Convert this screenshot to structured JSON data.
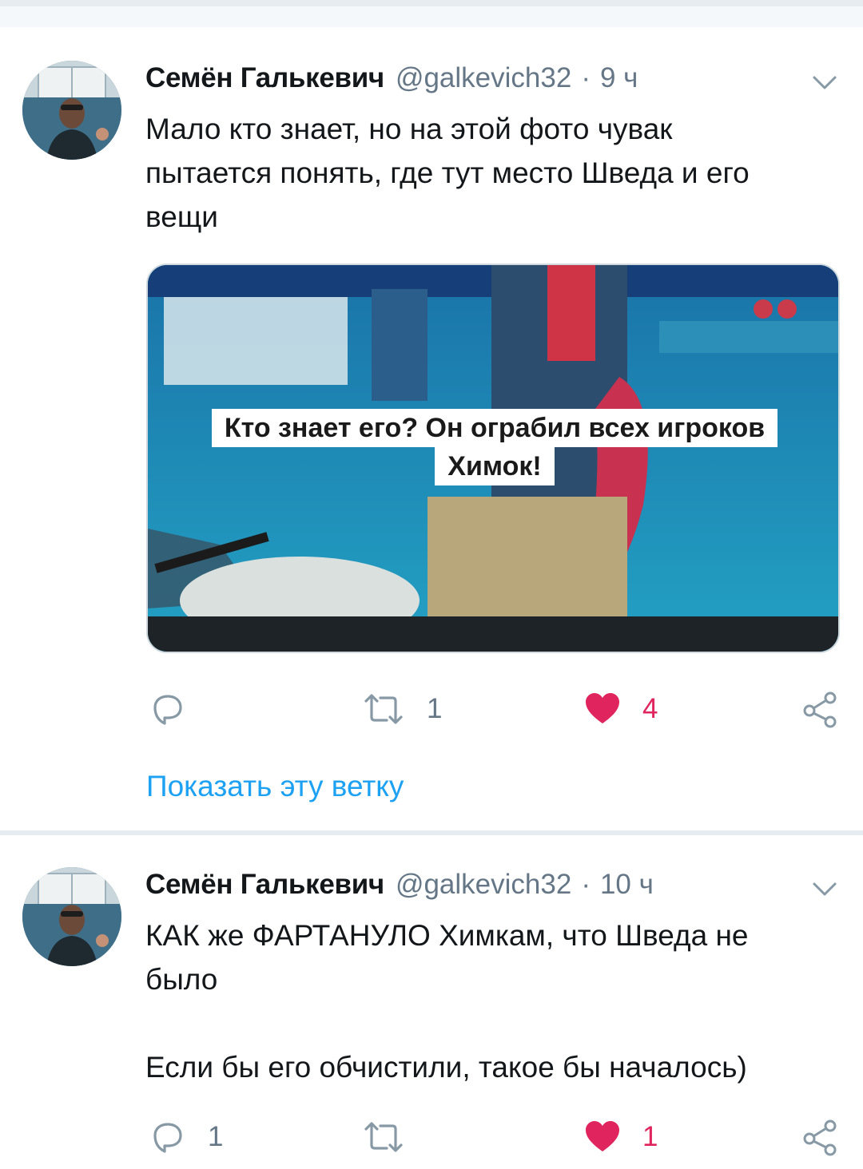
{
  "colors": {
    "link_blue": "#1da1f2",
    "like_red": "#e0245e",
    "secondary_text": "#657786",
    "divider": "#e6ecf0"
  },
  "tweets": [
    {
      "author_name": "Семён Галькевич",
      "handle": "@galkevich32",
      "separator": "·",
      "time": "9 ч",
      "text": "Мало кто знает, но на этой фото чувак\nпытается понять, где тут место Шведа и его\nвещи",
      "media": {
        "caption_line1": "Кто знает его? Он ограбил всех игроков",
        "caption_line2": "Химок!"
      },
      "actions": {
        "reply_icon": "reply-icon",
        "reply_count": "",
        "retweet_icon": "retweet-icon",
        "retweet_count": "1",
        "like_icon": "heart-icon",
        "like_count": "4",
        "liked": true,
        "share_icon": "share-icon"
      },
      "show_thread_label": "Показать эту ветку"
    },
    {
      "author_name": "Семён Галькевич",
      "handle": "@galkevich32",
      "separator": "·",
      "time": "10 ч",
      "text": "КАК же ФАРТАНУЛО Химкам, что Шведа не\nбыло\n\nЕсли бы его обчистили, такое бы началось)",
      "actions": {
        "reply_icon": "reply-icon",
        "reply_count": "1",
        "retweet_icon": "retweet-icon",
        "retweet_count": "",
        "like_icon": "heart-icon",
        "like_count": "1",
        "liked": true,
        "share_icon": "share-icon"
      }
    }
  ]
}
